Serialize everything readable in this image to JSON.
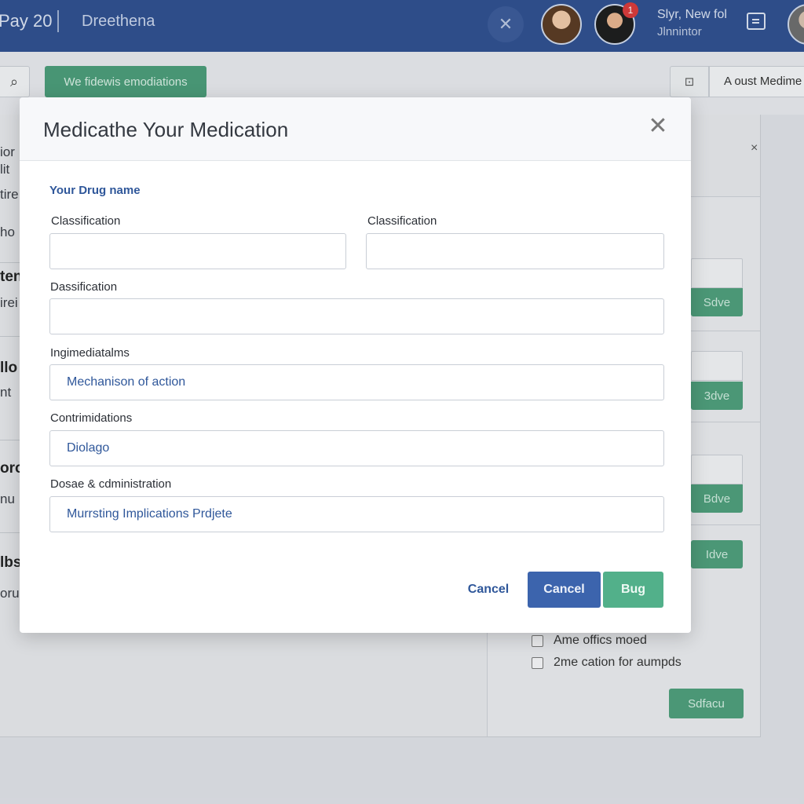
{
  "header": {
    "brand": "Pay 20",
    "app_name": "Dreethena",
    "close_glyph": "✕",
    "notification_count": "1",
    "user_line1": "Slyr, New fol",
    "user_line2": "Jlnnintor"
  },
  "background": {
    "search_glyph": "⌕",
    "green_button": "We fidewis emodiations",
    "lock_glyph": "⊡",
    "add_button": "A oust Medime",
    "close_glyph": "×",
    "left_items": [
      "ior",
      "lit",
      "tire",
      "ho",
      "ten",
      "irei",
      "llo",
      "nt",
      "oro",
      "nu",
      "lbs",
      "oru"
    ],
    "right_panel": {
      "save_labels": [
        "Sdve",
        "3dve",
        "Bdve",
        "Idve"
      ],
      "checkboxes": [
        "Ame offics moed",
        "2me cation for aumpds"
      ],
      "submit": "Sdfacu"
    }
  },
  "modal": {
    "title": "Medicathe Your Medication",
    "close_glyph": "✕",
    "section_label": "Your Drug name",
    "fields": {
      "classification_1": {
        "label": "Classification",
        "value": ""
      },
      "classification_2": {
        "label": "Classification",
        "value": ""
      },
      "dassification": {
        "label": "Dassification",
        "value": ""
      },
      "indications": {
        "label": "Ingimediatalms",
        "value": "Mechanison of action"
      },
      "contraindications": {
        "label": "Contrimidations",
        "value": "Diolago"
      },
      "dosage": {
        "label": "Dosae & cdministration",
        "value": "Murrsting Implications Prdjete"
      }
    },
    "buttons": {
      "link": "Cancel",
      "cancel": "Cancel",
      "primary": "Bug"
    }
  },
  "colors": {
    "topbar": "#2f4f8f",
    "accent_blue": "#3c64ad",
    "accent_green": "#52b08a",
    "link_blue": "#2f579a"
  },
  "icons": [
    "search-icon",
    "close-icon",
    "lock-icon",
    "menu-icon",
    "checkbox-icon"
  ]
}
